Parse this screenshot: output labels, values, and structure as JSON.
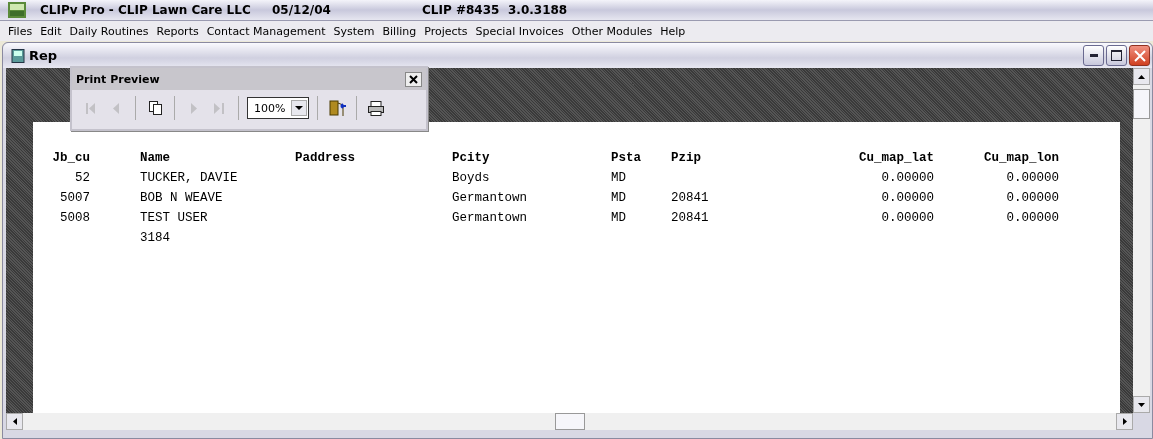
{
  "window": {
    "title": "CLIPv Pro - CLIP Lawn Care LLC",
    "date": "05/12/04",
    "account": "CLIP #8435",
    "version": "3.0.3188"
  },
  "menu": [
    "Files",
    "Edit",
    "Daily Routines",
    "Reports",
    "Contact Management",
    "System",
    "Billing",
    "Projects",
    "Special Invoices",
    "Other Modules",
    "Help"
  ],
  "child_window": {
    "title": "Rep"
  },
  "print_preview": {
    "title": "Print Preview",
    "tools": [
      {
        "kind": "first",
        "disabled": true
      },
      {
        "kind": "prev",
        "disabled": true
      },
      {
        "kind": "pages",
        "disabled": false
      },
      {
        "kind": "next",
        "disabled": true
      },
      {
        "kind": "last",
        "disabled": true
      },
      {
        "kind": "zoom",
        "value": "100%",
        "disabled": false
      },
      {
        "kind": "exit",
        "disabled": false
      },
      {
        "kind": "print",
        "disabled": false
      }
    ]
  },
  "report": {
    "columns": [
      {
        "label": "Jb_cu",
        "kind": "number"
      },
      {
        "label": "Name",
        "kind": "text"
      },
      {
        "label": "Paddress",
        "kind": "text"
      },
      {
        "label": "Pcity",
        "kind": "text"
      },
      {
        "label": "Psta",
        "kind": "text"
      },
      {
        "label": "Pzip",
        "kind": "text"
      },
      {
        "label": "Cu_map_lat",
        "kind": "number"
      },
      {
        "label": "Cu_map_lon",
        "kind": "number"
      }
    ],
    "rows": [
      [
        "52",
        "TUCKER, DAVIE",
        null,
        "Boyds",
        "MD",
        null,
        "0.00000",
        "0.00000"
      ],
      [
        "5007",
        "BOB N WEAVE",
        null,
        "Germantown",
        "MD",
        "20841",
        "0.00000",
        "0.00000"
      ],
      [
        "5008",
        "TEST USER",
        null,
        "Germantown",
        "MD",
        "20841",
        "0.00000",
        "0.00000"
      ],
      [
        null,
        "3184",
        null,
        null,
        null,
        null,
        null,
        null
      ]
    ]
  }
}
